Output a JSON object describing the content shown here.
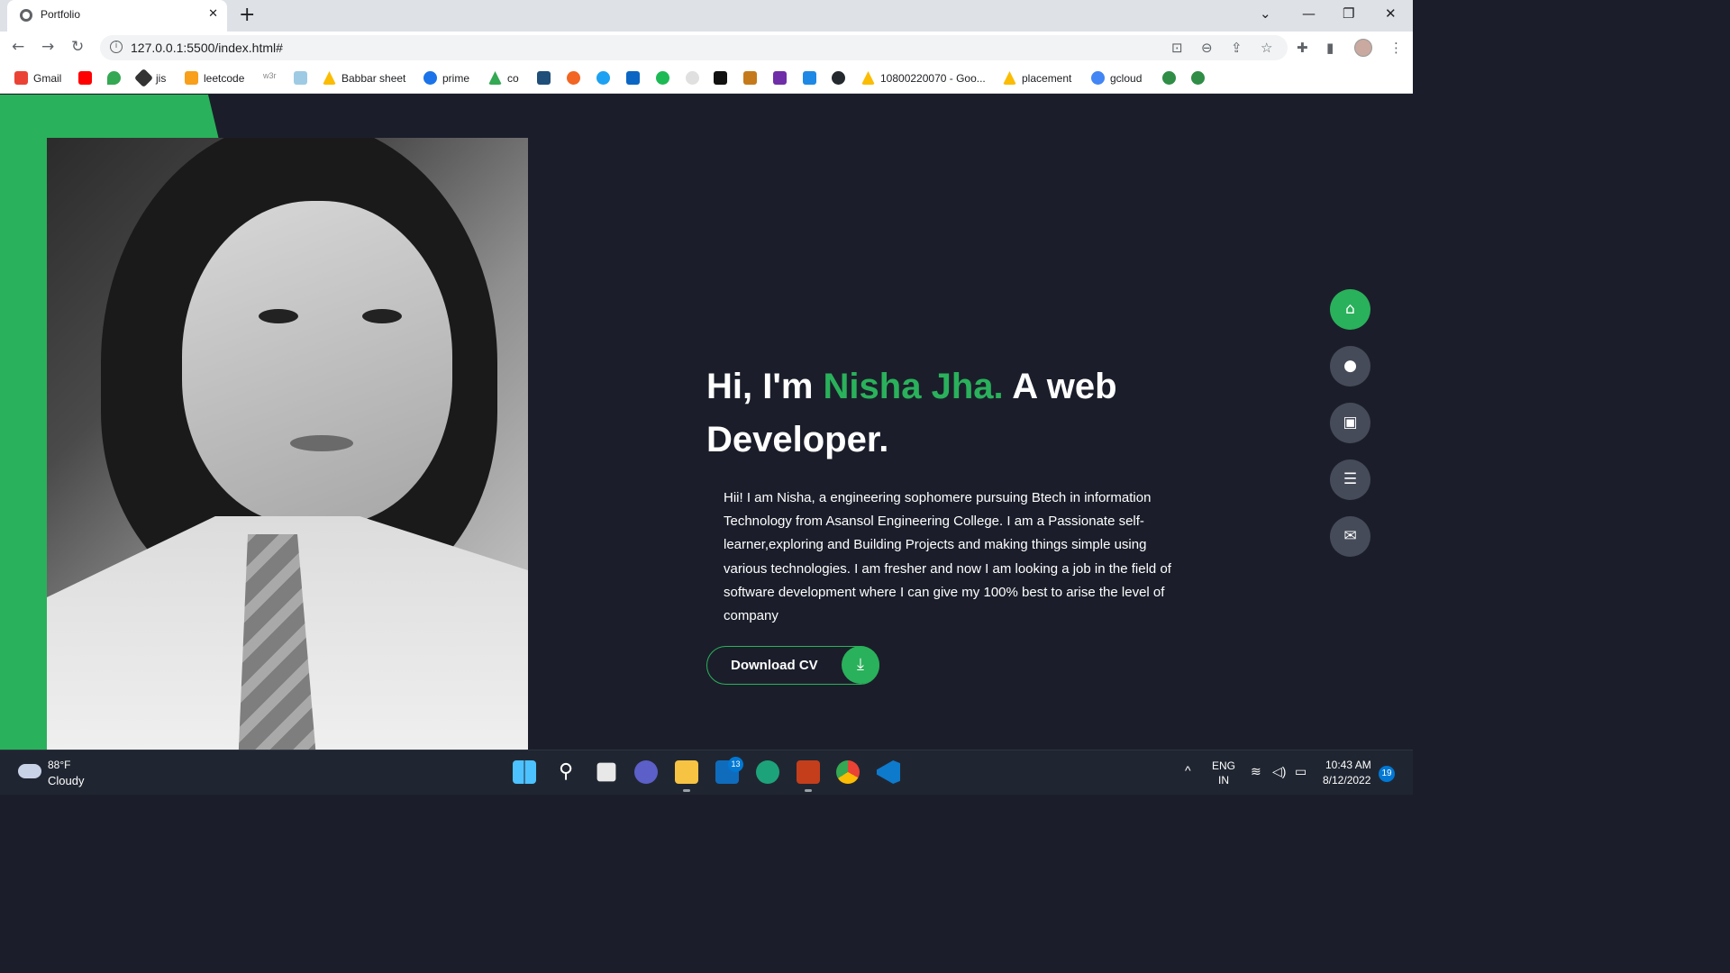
{
  "browser": {
    "tab_title": "Portfolio",
    "tab_close": "✕",
    "new_tab": "+",
    "url": "127.0.0.1:5500/index.html#",
    "bookmarks": [
      "Gmail",
      "jis",
      "leetcode",
      "w3r",
      "Babbar sheet",
      "prime",
      "co",
      "10800220070 - Goo...",
      "placement",
      "gcloud"
    ]
  },
  "hero": {
    "greeting": "Hi, I'm ",
    "name": "Nisha Jha.",
    "role_line": " A web Developer.",
    "description": "Hii! I am Nisha, a engineering sophomere pursuing Btech in information Technology from Asansol Engineering College. I am a Passionate self-learner,exploring and Building Projects and making things simple using various technologies. I am fresher and now I am looking a job in the field of software development where I can give my 100% best to arise the level of company",
    "cv_button": "Download CV"
  },
  "side_nav": [
    "home-icon",
    "user-icon",
    "briefcase-icon",
    "list-icon",
    "envelope-icon"
  ],
  "taskbar": {
    "temperature": "88°F",
    "weather": "Cloudy",
    "mail_badge": "13",
    "lang_top": "ENG",
    "lang_bottom": "IN",
    "time": "10:43 AM",
    "date": "8/12/2022",
    "notifications": "19"
  },
  "colors": {
    "accent": "#2ab15b",
    "page_bg": "#1b1e2a",
    "nav_button": "#454b59"
  }
}
